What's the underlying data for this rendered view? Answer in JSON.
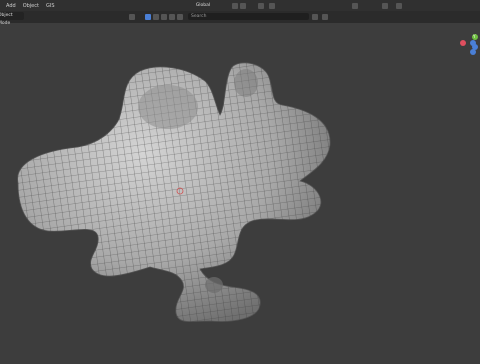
{
  "header": {
    "menu": [
      "Add",
      "Object",
      "GIS"
    ]
  },
  "toolbar": {
    "mode": "Object Mode",
    "transform_orientation": "Global",
    "search_placeholder": "Search"
  },
  "gizmo": {
    "x_color": "#e04f5f",
    "y_color": "#6fbf40",
    "z_color": "#4a7fd6",
    "y_label": "Y"
  },
  "colors": {
    "viewport_bg": "#3d3d3d",
    "mesh": "#bdbdbd",
    "wire": "#3a3a3a"
  }
}
